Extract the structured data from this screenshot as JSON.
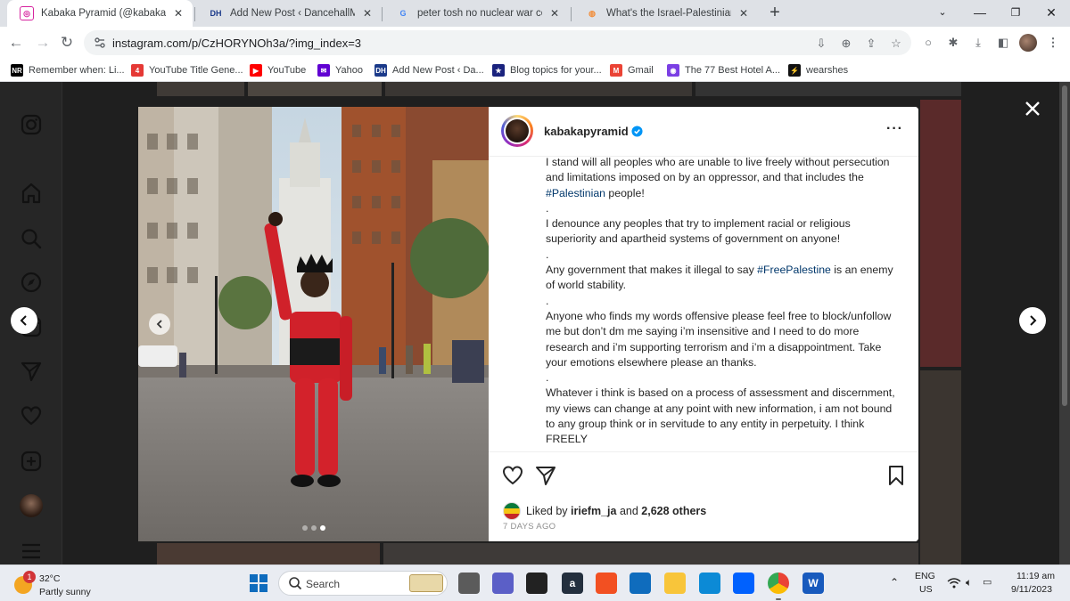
{
  "browser": {
    "tabs": [
      {
        "title": "Kabaka Pyramid (@kabakapyram",
        "favicon": "instagram-favicon",
        "color": "#d6249f",
        "active": true
      },
      {
        "title": "Add New Post ‹ DancehallMag –",
        "favicon": "dh-favicon",
        "color": "#1b3a8a",
        "active": false
      },
      {
        "title": "peter tosh no nuclear war conce",
        "favicon": "google-favicon",
        "color": "#4285f4",
        "active": false
      },
      {
        "title": "What's the Israel-Palestinian con",
        "favicon": "orange-favicon",
        "color": "#f28c38",
        "active": false
      }
    ],
    "url": "instagram.com/p/CzHORYNOh3a/?img_index=3",
    "bookmarks": [
      {
        "label": "Remember when: Li...",
        "icon": "nr-icon",
        "color": "#000000"
      },
      {
        "label": "YouTube Title Gene...",
        "icon": "number-4-icon",
        "color": "#e53935"
      },
      {
        "label": "YouTube",
        "icon": "youtube-icon",
        "color": "#ff0000"
      },
      {
        "label": "Yahoo",
        "icon": "yahoo-icon",
        "color": "#6001d2"
      },
      {
        "label": "Add New Post ‹ Da...",
        "icon": "dh-favicon",
        "color": "#1b3a8a"
      },
      {
        "label": "Blog topics for your...",
        "icon": "star-icon",
        "color": "#1a237e"
      },
      {
        "label": "Gmail",
        "icon": "gmail-icon",
        "color": "#ea4335"
      },
      {
        "label": "The 77 Best Hotel A...",
        "icon": "globe-icon",
        "color": "#7b3fe4"
      },
      {
        "label": "wearshes",
        "icon": "bolt-icon",
        "color": "#111111"
      }
    ]
  },
  "post": {
    "username": "kabakapyramid",
    "caption": [
      {
        "parts": [
          {
            "t": "I stand will all peoples who are unable to live freely without persecution and limitations imposed on by an oppressor, and that includes the "
          },
          {
            "t": "#Palestinian",
            "tag": true
          },
          {
            "t": " people!"
          }
        ]
      },
      {
        "parts": [
          {
            "t": "."
          }
        ]
      },
      {
        "parts": [
          {
            "t": "I denounce any peoples that try to implement racial or religious superiority and apartheid systems of government on anyone!"
          }
        ]
      },
      {
        "parts": [
          {
            "t": "."
          }
        ]
      },
      {
        "parts": [
          {
            "t": "Any government that makes it illegal to say "
          },
          {
            "t": "#FreePalestine",
            "tag": true
          },
          {
            "t": " is an enemy of world stability."
          }
        ]
      },
      {
        "parts": [
          {
            "t": "."
          }
        ]
      },
      {
        "parts": [
          {
            "t": "Anyone who finds my words offensive please feel free to block/unfollow me but don’t dm me saying i’m insensitive and I need to do more research and i’m supporting terrorism and i’m a disappointment. Take your emotions elsewhere please an thanks."
          }
        ]
      },
      {
        "parts": [
          {
            "t": "."
          }
        ]
      },
      {
        "parts": [
          {
            "t": "Whatever i think is based on a process of assessment and discernment, my views can change at any point with new information, i am not bound to any group think or in servitude to any entity in perpetuity. I think FREELY"
          }
        ]
      }
    ],
    "liked_by_prefix": "Liked by",
    "liked_by_user": "iriefm_ja",
    "liked_by_and": "and",
    "liked_by_others": "2,628 others",
    "time_ago": "7 DAYS AGO",
    "carousel": {
      "total": 3,
      "current": 3
    }
  },
  "taskbar": {
    "weather_temp": "32°C",
    "weather_cond": "Partly sunny",
    "weather_badge": "1",
    "search_placeholder": "Search",
    "lang_top": "ENG",
    "lang_bottom": "US",
    "time": "11:19 am",
    "date": "9/11/2023",
    "apps": [
      {
        "name": "file-explorer-dark-icon",
        "glyph": "",
        "color": "#5b5b5b"
      },
      {
        "name": "video-chat-icon",
        "glyph": "",
        "color": "#5b5fc7"
      },
      {
        "name": "app-bolt-icon",
        "glyph": "",
        "color": "#222222"
      },
      {
        "name": "amazon-icon",
        "glyph": "a",
        "color": "#232f3e"
      },
      {
        "name": "store-icon",
        "glyph": "",
        "color": "#f25022"
      },
      {
        "name": "mail-icon",
        "glyph": "",
        "color": "#0f6cbd"
      },
      {
        "name": "folder-icon",
        "glyph": "",
        "color": "#f8c53a"
      },
      {
        "name": "edge-icon",
        "glyph": "",
        "color": "#0c8ad6"
      },
      {
        "name": "dropbox-icon",
        "glyph": "",
        "color": "#0061fe"
      },
      {
        "name": "chrome-icon",
        "glyph": "",
        "color": "#34a853"
      },
      {
        "name": "word-icon",
        "glyph": "W",
        "color": "#185abd"
      }
    ]
  }
}
